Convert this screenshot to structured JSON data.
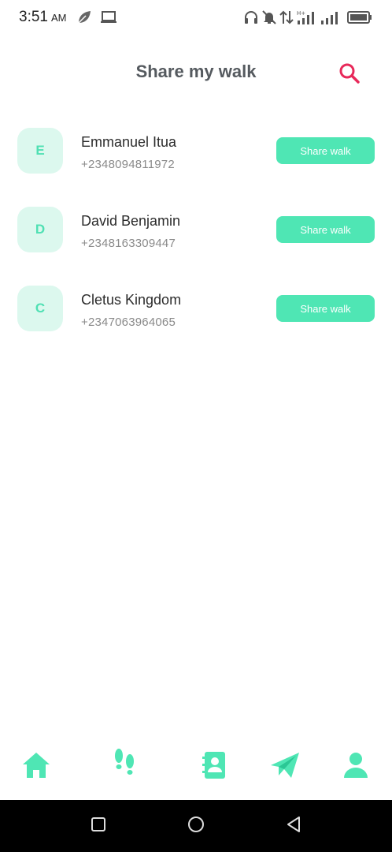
{
  "status_bar": {
    "time": "3:51",
    "ampm": "AM",
    "icons": [
      "leaf-icon",
      "laptop-icon",
      "headset-icon",
      "mute-icon",
      "data-arrows-icon",
      "hplus-signal-icon",
      "signal-icon",
      "battery-icon"
    ]
  },
  "header": {
    "title": "Share my walk",
    "search_icon": "search-icon",
    "accent_color": "#e8295a"
  },
  "contacts": [
    {
      "initial": "E",
      "name": "Emmanuel Itua",
      "phone": "+2348094811972",
      "button": "Share walk"
    },
    {
      "initial": "D",
      "name": "David Benjamin",
      "phone": "+2348163309447",
      "button": "Share walk"
    },
    {
      "initial": "C",
      "name": "Cletus Kingdom",
      "phone": "+2347063964065",
      "button": "Share walk"
    }
  ],
  "bottom_nav": {
    "items": [
      "home-icon",
      "footsteps-icon",
      "contacts-book-icon",
      "send-icon",
      "profile-icon"
    ],
    "color": "#4fe6b4"
  },
  "system_nav": {
    "items": [
      "recents-icon",
      "home-circle-icon",
      "back-icon"
    ]
  }
}
